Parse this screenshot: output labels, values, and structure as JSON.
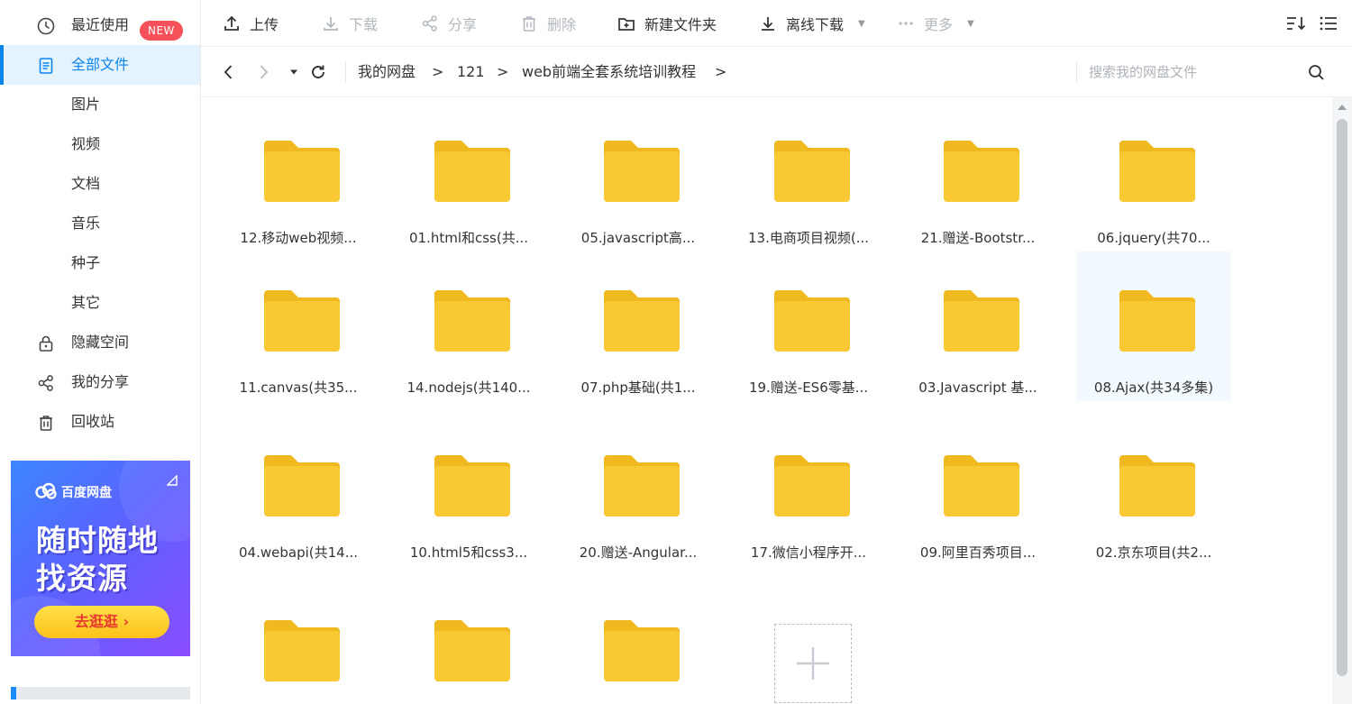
{
  "sidebar": {
    "recent": "最近使用",
    "badge": "NEW",
    "all_files": "全部文件",
    "images": "图片",
    "videos": "视频",
    "docs": "文档",
    "music": "音乐",
    "torrents": "种子",
    "other": "其它",
    "hidden_space": "隐藏空间",
    "my_share": "我的分享",
    "recycle_bin": "回收站",
    "storage_fraction": 0.03
  },
  "ad": {
    "brand": "百度网盘",
    "line1": "随时随地",
    "line2": "找资源",
    "button": "去逛逛 ›"
  },
  "toolbar": {
    "upload": "上传",
    "download": "下载",
    "share": "分享",
    "delete": "删除",
    "new_folder": "新建文件夹",
    "offline_download": "离线下载",
    "more": "更多"
  },
  "nav": {
    "breadcrumb": [
      "我的网盘",
      "121",
      "web前端全套系统培训教程"
    ],
    "separator": ">",
    "search_placeholder": "搜索我的网盘文件"
  },
  "folders": [
    "12.移动web视频...",
    "01.html和css(共...",
    "05.javascript高...",
    "13.电商项目视频(...",
    "21.赠送-Bootstr...",
    "06.jquery(共70...",
    "11.canvas(共35...",
    "14.nodejs(共140...",
    "07.php基础(共1...",
    "19.赠送-ES6零基...",
    "03.Javascript 基...",
    "08.Ajax(共34多集)",
    "04.webapi(共14...",
    "10.html5和css3...",
    "20.赠送-Angular...",
    "17.微信小程序开...",
    "09.阿里百秀项目...",
    "02.京东项目(共2...",
    "",
    "",
    ""
  ],
  "colors": {
    "accent": "#0b84ee",
    "folder": "#f9c933",
    "folder_tab": "#efb91f",
    "badge": "#f65158"
  }
}
